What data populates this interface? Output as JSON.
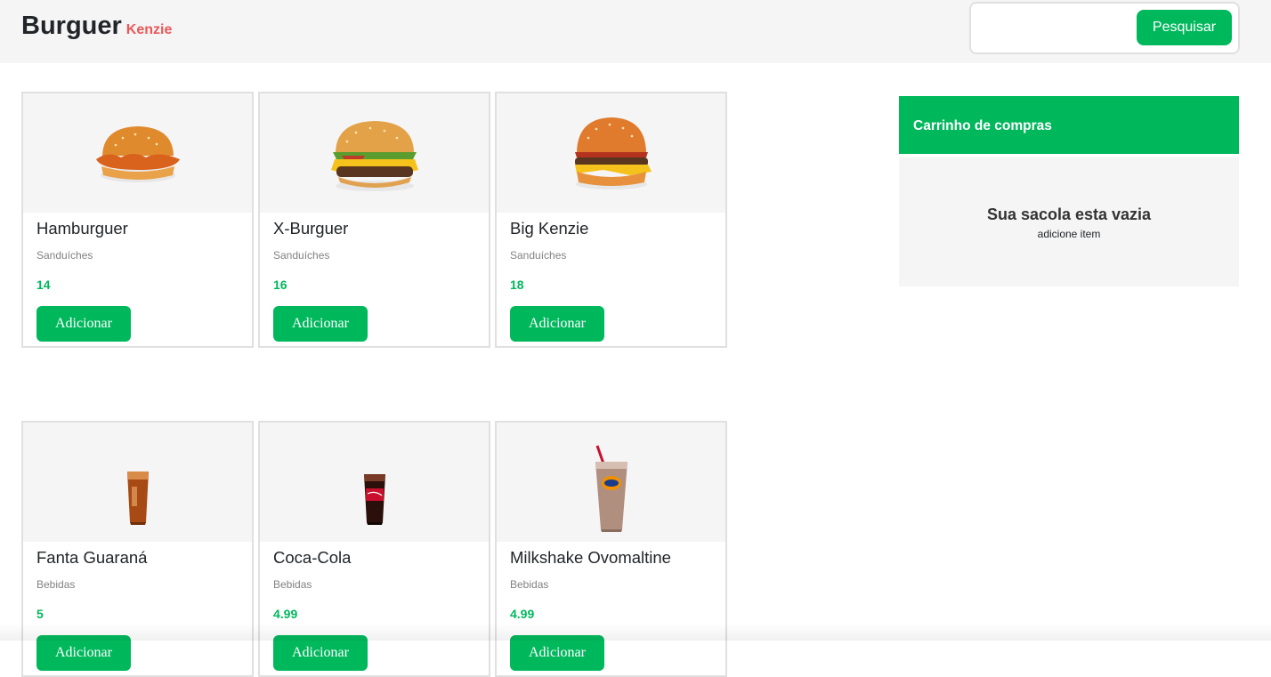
{
  "brand": {
    "name": "Burguer",
    "sub": "Kenzie"
  },
  "search": {
    "placeholder": "",
    "button_label": "Pesquisar"
  },
  "products": [
    {
      "name": "Hamburguer",
      "category": "Sanduíches",
      "price": "14",
      "button_label": "Adicionar",
      "image": "burger-chicken-image"
    },
    {
      "name": "X-Burguer",
      "category": "Sanduíches",
      "price": "16",
      "button_label": "Adicionar",
      "image": "cheeseburger-image"
    },
    {
      "name": "Big Kenzie",
      "category": "Sanduíches",
      "price": "18",
      "button_label": "Adicionar",
      "image": "big-burger-image"
    },
    {
      "name": "Fanta Guaraná",
      "category": "Bebidas",
      "price": "5",
      "button_label": "Adicionar",
      "image": "guarana-glass-image"
    },
    {
      "name": "Coca-Cola",
      "category": "Bebidas",
      "price": "4.99",
      "button_label": "Adicionar",
      "image": "cola-glass-image"
    },
    {
      "name": "Milkshake Ovomaltine",
      "category": "Bebidas",
      "price": "4.99",
      "button_label": "Adicionar",
      "image": "milkshake-image"
    }
  ],
  "cart": {
    "title": "Carrinho de compras",
    "empty_message": "Sua sacola esta vazia",
    "empty_hint": "adicione item"
  },
  "colors": {
    "brand_green": "#00b85c",
    "brand_red": "#eb5757",
    "panel_gray": "#f5f5f5",
    "border_gray": "#e0e0e0"
  }
}
